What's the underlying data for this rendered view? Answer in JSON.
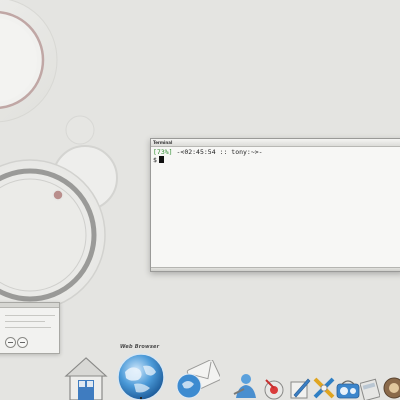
{
  "terminal": {
    "title": "Terminal",
    "prompt_battery": "[73%]",
    "prompt_rest": " -<02:45:54 :: tony:~>-",
    "prompt_symbol": "$"
  },
  "dock": {
    "hover_label": "Web Browser",
    "items": [
      {
        "name": "home",
        "icon": "home-icon"
      },
      {
        "name": "web-browser",
        "icon": "globe-icon"
      },
      {
        "name": "mail",
        "icon": "mail-icon"
      },
      {
        "name": "people",
        "icon": "user-icon"
      },
      {
        "name": "preferences",
        "icon": "preferences-icon"
      },
      {
        "name": "editor",
        "icon": "pen-icon"
      },
      {
        "name": "tools",
        "icon": "tools-icon"
      },
      {
        "name": "player",
        "icon": "player-icon"
      },
      {
        "name": "calculator",
        "icon": "calculator-icon"
      },
      {
        "name": "system",
        "icon": "system-icon"
      }
    ]
  },
  "colors": {
    "background": "#e4e4e1",
    "battery_text": "#2e8b2e",
    "wallpaper_accent": "#b98e8c",
    "globe_blue": "#2f7fc4"
  }
}
